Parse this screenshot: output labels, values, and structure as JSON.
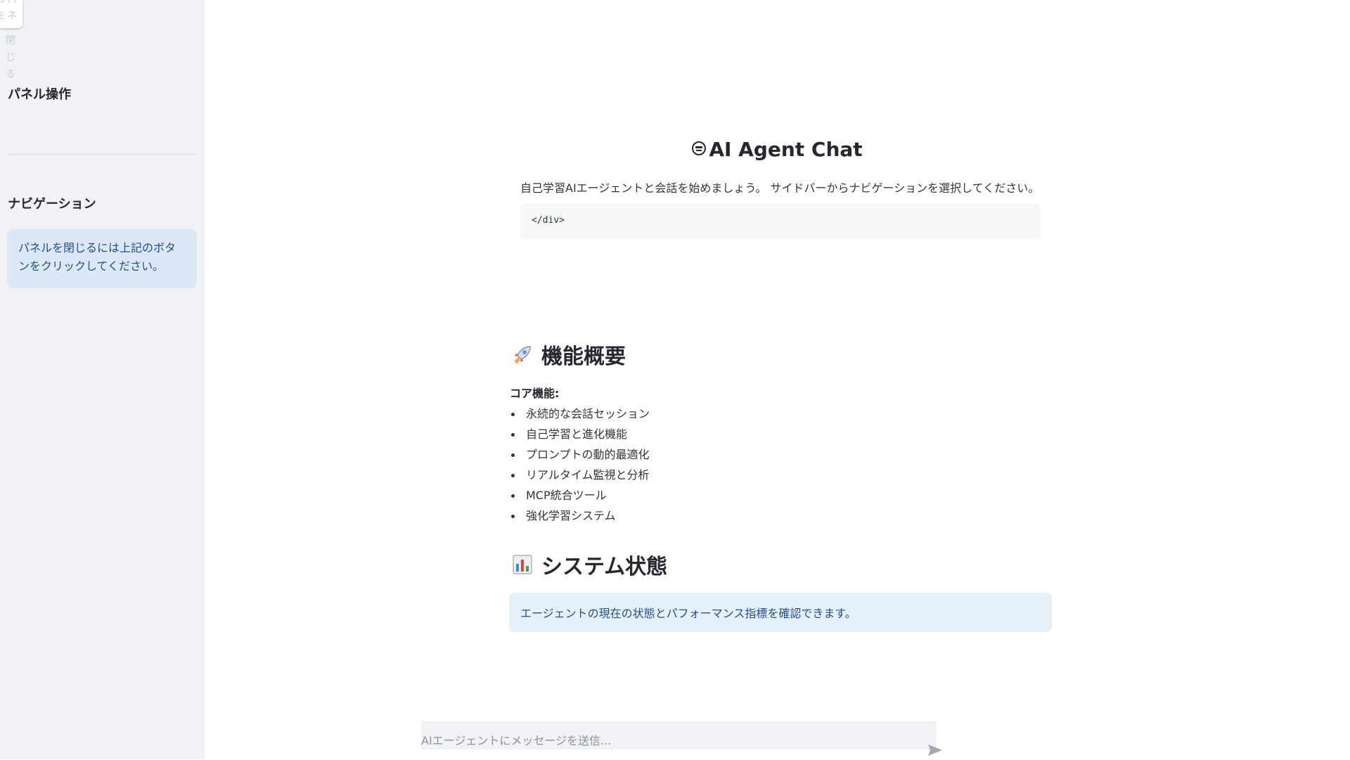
{
  "sidebar": {
    "close_button_label": "パネルを閉じる",
    "close_button_spill": [
      "ル",
      "を",
      "閉",
      "じ",
      "る"
    ],
    "panel_heading": "パネル操作",
    "nav_heading": "ナビゲーション",
    "info_text": "パネルを閉じるには上記のボタンをクリックしてください。"
  },
  "main": {
    "title": "AI Agent Chat",
    "title_icon": "robot-icon",
    "intro": "自己学習AIエージェントと会話を始めましょう。 サイドバーからナビゲーションを選択してください。",
    "code_snippet": "</div>",
    "features": {
      "heading": "機能概要",
      "icon": "rocket-icon",
      "core_label": "コア機能:",
      "items": [
        "永続的な会話セッション",
        "自己学習と進化機能",
        "プロンプトの動的最適化",
        "リアルタイム監視と分析",
        "MCP統合ツール",
        "強化学習システム"
      ]
    },
    "status": {
      "heading": "システム状態",
      "icon": "bar-chart-icon",
      "info": "エージェントの現在の状態とパフォーマンス指標を確認できます。"
    }
  },
  "chat": {
    "placeholder": "AIエージェントにメッセージを送信...",
    "value": "",
    "send_icon": "send-icon"
  },
  "colors": {
    "sidebar_bg": "#f0f2f6",
    "info_bg": "#dce8f5",
    "info_text": "#1f4f86",
    "text": "#31333f"
  }
}
